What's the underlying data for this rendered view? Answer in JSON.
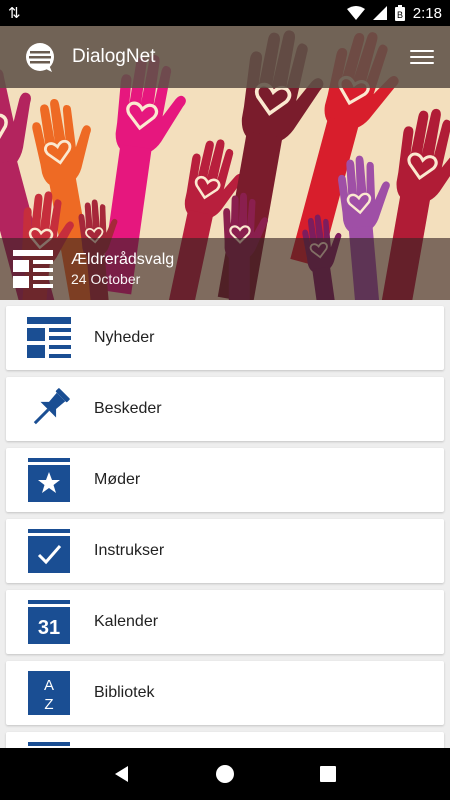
{
  "status_bar": {
    "time": "2:18",
    "battery_glyph": "B"
  },
  "app_bar": {
    "title": "DialogNet"
  },
  "hero": {
    "news_title": "Ældrerådsvalg",
    "news_date": "24 October"
  },
  "menu": {
    "items": [
      {
        "label": "Nyheder",
        "icon": "news-icon"
      },
      {
        "label": "Beskeder",
        "icon": "pin-icon"
      },
      {
        "label": "Møder",
        "icon": "calendar-star-icon"
      },
      {
        "label": "Instrukser",
        "icon": "calendar-check-icon"
      },
      {
        "label": "Kalender",
        "icon": "calendar-day-icon",
        "icon_text": "31"
      },
      {
        "label": "Bibliotek",
        "icon": "library-az-icon",
        "icon_text_top": "A",
        "icon_text_bottom": "Z"
      },
      {
        "label": "",
        "icon": "calendar-icon"
      }
    ]
  },
  "colors": {
    "accent": "#1a4e93",
    "app_bar": "#5f5248",
    "nav_bar": "#000000"
  }
}
